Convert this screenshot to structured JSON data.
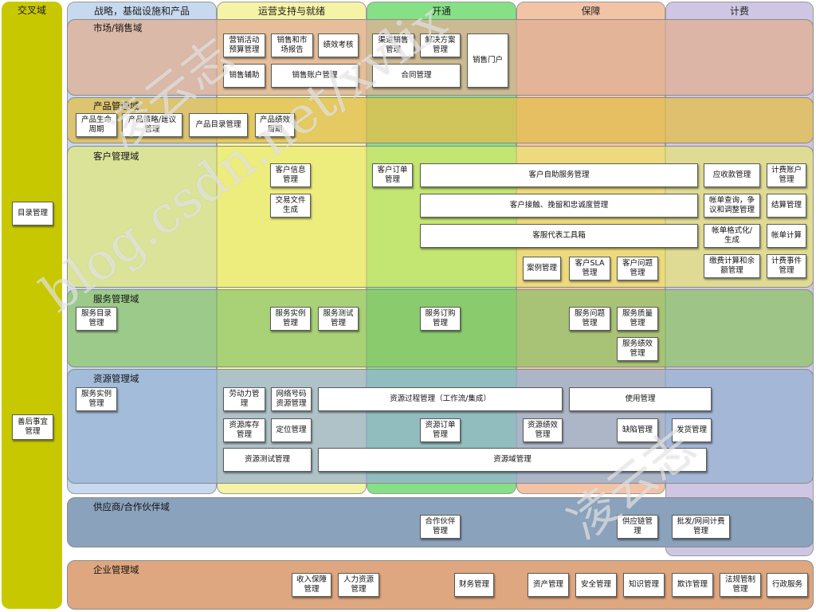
{
  "left_column": {
    "title": "交叉域",
    "items": [
      "目录管理",
      "善后事宜\n管理"
    ]
  },
  "columns": [
    "战略，基础设施和产品",
    "运营支持与就绪",
    "开通",
    "保障",
    "计费"
  ],
  "domains": {
    "market": "市场/销售域",
    "product": "产品管理域",
    "customer": "客户管理域",
    "service": "服务管理域",
    "resource": "资源管理域",
    "supplier": "供应商/合作伙伴域",
    "enterprise": "企业管理域"
  },
  "boxes": {
    "market": [
      "营销活动\n预算管理",
      "销售和市\n场报告",
      "绩效考核",
      "销售辅助",
      "销售账户管理",
      "渠道销售\n管理",
      "解决方案\n管理",
      "销售门户",
      "合同管理"
    ],
    "product": [
      "产品生命\n周期",
      "产品策略/建议\n管理",
      "产品目录管理",
      "产品绩效\n周期"
    ],
    "customer": [
      "客户信息\n管理",
      "交易文件\n生成",
      "客户订单\n管理",
      "客户自助服务管理",
      "客户接触、挽留和忠诚度管理",
      "客服代表工具箱",
      "案例管理",
      "客户SLA\n管理",
      "客户问题\n管理",
      "应收款管理",
      "计费账户\n管理",
      "帐单查询，争\n议和调整管理",
      "结算管理",
      "帐单格式化/\n生成",
      "帐单计算",
      "缴费计算和余\n额管理",
      "计费事件\n管理"
    ],
    "service": [
      "服务目录\n管理",
      "服务实例\n管理",
      "服务测试\n管理",
      "服务订购\n管理",
      "服务问题\n管理",
      "服务质量\n管理",
      "服务绩效\n管理"
    ],
    "resource": [
      "服务实例\n管理",
      "劳动力管\n理",
      "网络号码\n资源管理",
      "资源过程管理（工作流/集成）",
      "使用管理",
      "资源库存\n管理",
      "定位管理",
      "资源订单\n管理",
      "资源绩效\n管理",
      "缺陷管理",
      "发货管理",
      "资源测试管理",
      "资源域管理"
    ],
    "supplier": [
      "合作伙伴\n管理",
      "供应链管\n理",
      "批发/网间计费\n管理"
    ],
    "enterprise": [
      "收入保障\n管理",
      "人力资源\n管理",
      "财务管理",
      "资产管理",
      "安全管理",
      "知识管理",
      "欺诈管理",
      "法规管制\n管理",
      "行政服务"
    ]
  },
  "watermarks": [
    "凌云志",
    "blog.csdn.net/xvlix",
    "凌云志"
  ],
  "colors": {
    "cross": "#c8c800",
    "col_strategy": "#c6d9ee",
    "col_ops": "#f5f3a6",
    "col_fulfill": "#86e086",
    "col_assure": "#f3c3a6",
    "col_billing": "#cfc6e3",
    "market": "#e9c3af",
    "product": "#e7c766",
    "customer": "#eded7a",
    "service": "#9fcf74",
    "resource": "#a7bdd5",
    "supplier": "#8ba2bd",
    "enterprise": "#dfa77f"
  }
}
